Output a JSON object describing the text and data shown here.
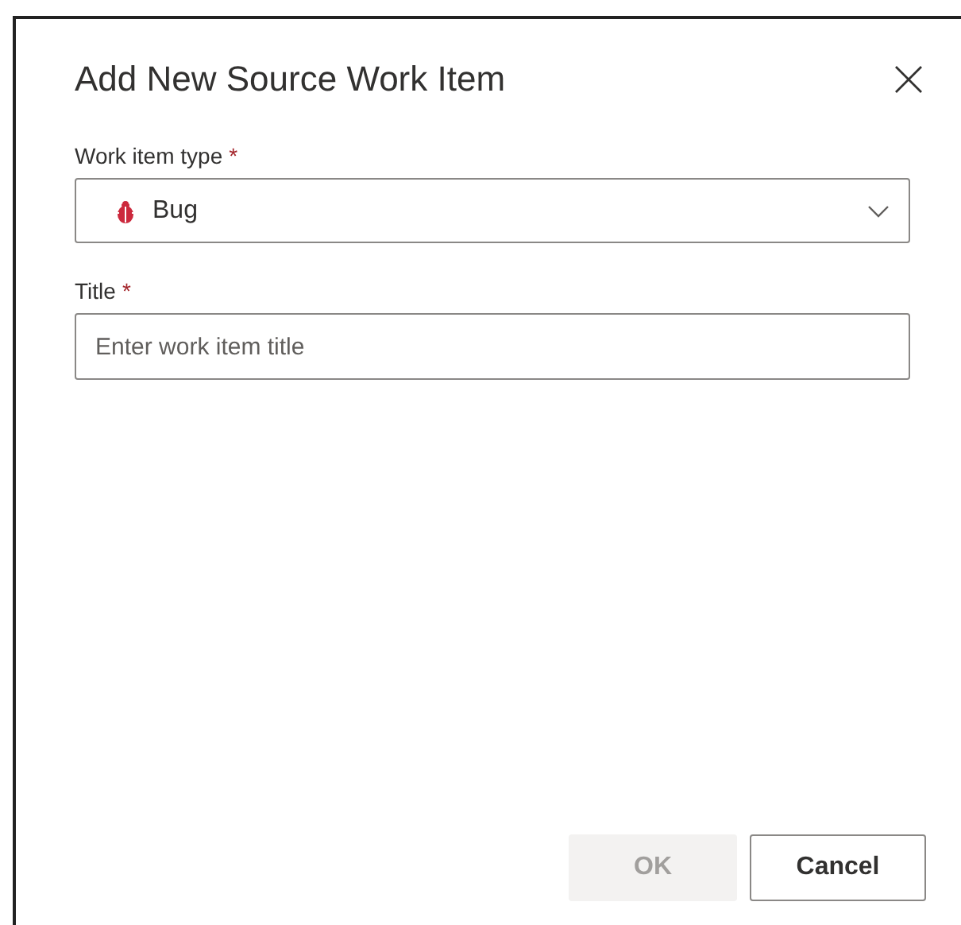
{
  "dialog": {
    "title": "Add New Source Work Item"
  },
  "fields": [
    {
      "kind": "select",
      "label": "Work item type",
      "required_mark": "*",
      "value": "Bug"
    },
    {
      "kind": "text",
      "label": "Title",
      "required_mark": "*",
      "placeholder": "Enter work item title"
    }
  ],
  "buttons": [
    {
      "label": "OK",
      "disabled": true
    },
    {
      "label": "Cancel",
      "disabled": false
    }
  ]
}
